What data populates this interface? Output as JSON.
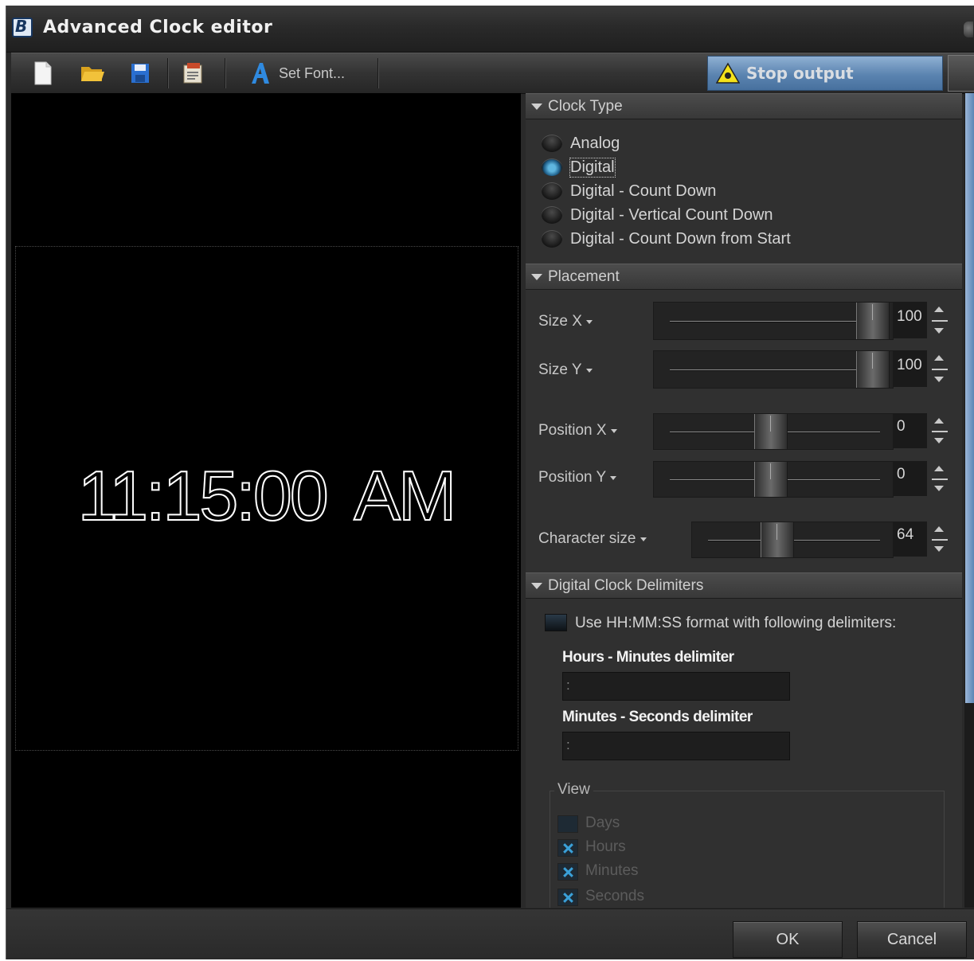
{
  "window": {
    "title": "Advanced Clock editor",
    "app_icon_letter": "B"
  },
  "toolbar": {
    "icons": [
      "new-document-icon",
      "open-folder-icon",
      "save-disk-icon",
      "clipboard-icon",
      "font-a-icon",
      "warning-triangle-icon"
    ],
    "set_font_label": "Set Font...",
    "stop_output_label": "Stop output"
  },
  "preview": {
    "clock_text": "11:15:00 AM"
  },
  "clock_type": {
    "title": "Clock Type",
    "options": [
      {
        "label": "Analog",
        "selected": false
      },
      {
        "label": "Digital",
        "selected": true
      },
      {
        "label": "Digital - Count Down",
        "selected": false
      },
      {
        "label": "Digital - Vertical Count Down",
        "selected": false
      },
      {
        "label": "Digital - Count Down from Start",
        "selected": false
      }
    ]
  },
  "placement": {
    "title": "Placement",
    "size_x": {
      "label": "Size X",
      "value": "100"
    },
    "size_y": {
      "label": "Size Y",
      "value": "100"
    },
    "position_x": {
      "label": "Position X",
      "value": "0"
    },
    "position_y": {
      "label": "Position Y",
      "value": "0"
    },
    "character_size": {
      "label": "Character size",
      "value": "64"
    }
  },
  "delimiters": {
    "title": "Digital Clock Delimiters",
    "use_format_label": "Use HH:MM:SS format with following delimiters:",
    "use_format_checked": false,
    "hours_minutes_label": "Hours - Minutes delimiter",
    "hours_minutes_value": ":",
    "minutes_seconds_label": "Minutes - Seconds delimiter",
    "minutes_seconds_value": ":"
  },
  "view": {
    "title": "View",
    "items": [
      {
        "label": "Days",
        "checked": false
      },
      {
        "label": "Hours",
        "checked": true
      },
      {
        "label": "Minutes",
        "checked": true
      },
      {
        "label": "Seconds",
        "checked": true
      }
    ]
  },
  "buttons": {
    "ok": "OK",
    "cancel": "Cancel"
  },
  "colors": {
    "accent": "#5b84b0",
    "background": "#303030",
    "preview_bg": "#000000",
    "radio_selected": "#5fb6e0"
  }
}
